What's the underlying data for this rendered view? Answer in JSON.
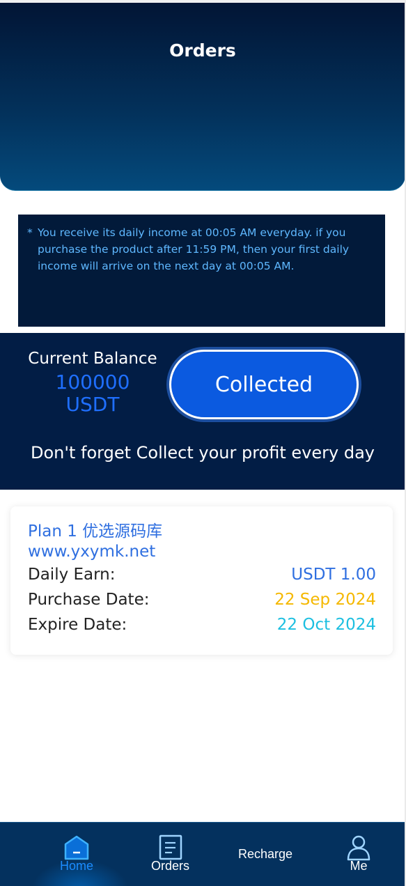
{
  "header": {
    "title": "Orders"
  },
  "notice": {
    "bullet": "*",
    "text": "You receive its daily income at 00:05 AM everyday. if you purchase the product after 11:59 PM, then your first daily income will arrive on the next day at 00:05 AM."
  },
  "balance": {
    "label": "Current Balance",
    "amount": "100000",
    "currency": "USDT",
    "collect_button": "Collected",
    "reminder": "Don't forget Collect your profit every day"
  },
  "orders": [
    {
      "plan": "Plan 1 优选源码库",
      "url": "www.yxymk.net",
      "rows": [
        {
          "label": "Daily Earn:",
          "value": "USDT 1.00",
          "color": "#2f6fe0"
        },
        {
          "label": "Purchase Date:",
          "value": "22 Sep 2024",
          "color": "#f5b800"
        },
        {
          "label": "Expire Date:",
          "value": "22 Oct 2024",
          "color": "#1cbfe0"
        }
      ]
    }
  ],
  "nav": {
    "items": [
      {
        "label": "Home",
        "icon": "home-icon",
        "active": true
      },
      {
        "label": "Orders",
        "icon": "orders-icon",
        "active": false
      },
      {
        "label": "Recharge",
        "icon": "",
        "active": false
      },
      {
        "label": "Me",
        "icon": "user-icon",
        "active": false
      }
    ]
  },
  "colors": {
    "header_dark": "#021535",
    "panel_navy": "#021d45",
    "accent_blue": "#1f6fff",
    "nav_active": "#1b8cff"
  }
}
